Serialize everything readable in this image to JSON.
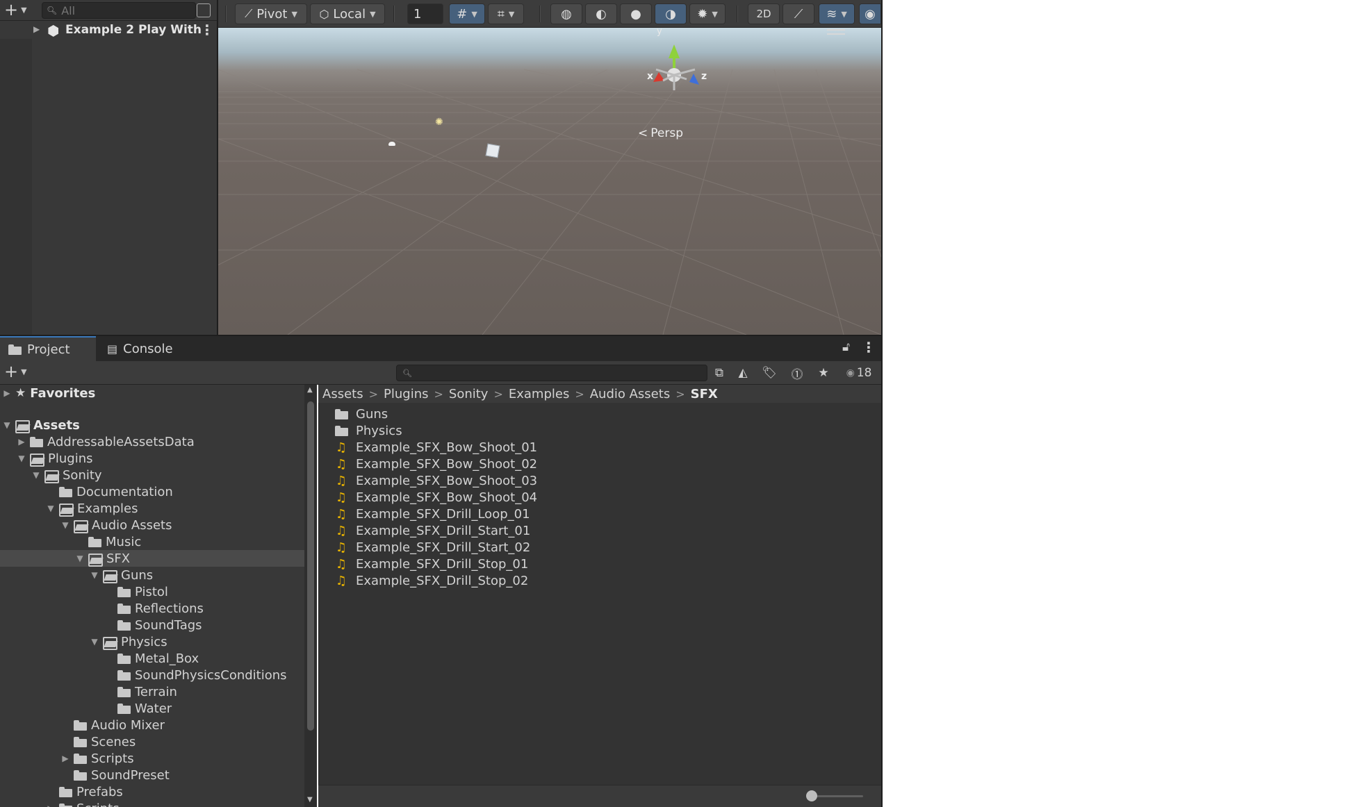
{
  "hierarchy": {
    "search_placeholder": "All",
    "scene_name": "Example 2 Play With"
  },
  "scene_toolbar": {
    "pivot": "Pivot",
    "local": "Local",
    "grid_snap_value": "1",
    "visible_count": "18"
  },
  "scene": {
    "gizmo_x": "x",
    "gizmo_y": "y",
    "gizmo_z": "z",
    "projection_label": "Persp"
  },
  "tabs": {
    "project": "Project",
    "console": "Console"
  },
  "folder_tree": [
    {
      "label": "Favorites",
      "indent": 0,
      "arrow": "▶",
      "icon": "star",
      "bold": true
    },
    {
      "label": "Assets",
      "indent": 0,
      "arrow": "▼",
      "icon": "open",
      "bold": true
    },
    {
      "label": "AddressableAssetsData",
      "indent": 1,
      "arrow": "▶",
      "icon": "folder"
    },
    {
      "label": "Plugins",
      "indent": 1,
      "arrow": "▼",
      "icon": "open"
    },
    {
      "label": "Sonity",
      "indent": 2,
      "arrow": "▼",
      "icon": "open"
    },
    {
      "label": "Documentation",
      "indent": 3,
      "arrow": "",
      "icon": "folder"
    },
    {
      "label": "Examples",
      "indent": 3,
      "arrow": "▼",
      "icon": "open"
    },
    {
      "label": "Audio Assets",
      "indent": 4,
      "arrow": "▼",
      "icon": "open"
    },
    {
      "label": "Music",
      "indent": 5,
      "arrow": "",
      "icon": "folder"
    },
    {
      "label": "SFX",
      "indent": 5,
      "arrow": "▼",
      "icon": "open",
      "selected": true
    },
    {
      "label": "Guns",
      "indent": 6,
      "arrow": "▼",
      "icon": "open"
    },
    {
      "label": "Pistol",
      "indent": 7,
      "arrow": "",
      "icon": "folder"
    },
    {
      "label": "Reflections",
      "indent": 7,
      "arrow": "",
      "icon": "folder"
    },
    {
      "label": "SoundTags",
      "indent": 7,
      "arrow": "",
      "icon": "folder"
    },
    {
      "label": "Physics",
      "indent": 6,
      "arrow": "▼",
      "icon": "open"
    },
    {
      "label": "Metal_Box",
      "indent": 7,
      "arrow": "",
      "icon": "folder"
    },
    {
      "label": "SoundPhysicsConditions",
      "indent": 7,
      "arrow": "",
      "icon": "folder"
    },
    {
      "label": "Terrain",
      "indent": 7,
      "arrow": "",
      "icon": "folder"
    },
    {
      "label": "Water",
      "indent": 7,
      "arrow": "",
      "icon": "folder"
    },
    {
      "label": "Audio Mixer",
      "indent": 4,
      "arrow": "",
      "icon": "folder"
    },
    {
      "label": "Scenes",
      "indent": 4,
      "arrow": "",
      "icon": "folder"
    },
    {
      "label": "Scripts",
      "indent": 4,
      "arrow": "▶",
      "icon": "folder"
    },
    {
      "label": "SoundPreset",
      "indent": 4,
      "arrow": "",
      "icon": "folder"
    },
    {
      "label": "Prefabs",
      "indent": 3,
      "arrow": "",
      "icon": "folder"
    },
    {
      "label": "Scripts",
      "indent": 3,
      "arrow": "▶",
      "icon": "folder"
    }
  ],
  "breadcrumb": [
    "Assets",
    "Plugins",
    "Sonity",
    "Examples",
    "Audio Assets",
    "SFX"
  ],
  "files": [
    {
      "label": "Guns",
      "type": "folder"
    },
    {
      "label": "Physics",
      "type": "folder"
    },
    {
      "label": "Example_SFX_Bow_Shoot_01",
      "type": "audio"
    },
    {
      "label": "Example_SFX_Bow_Shoot_02",
      "type": "audio"
    },
    {
      "label": "Example_SFX_Bow_Shoot_03",
      "type": "audio"
    },
    {
      "label": "Example_SFX_Bow_Shoot_04",
      "type": "audio"
    },
    {
      "label": "Example_SFX_Drill_Loop_01",
      "type": "audio"
    },
    {
      "label": "Example_SFX_Drill_Start_01",
      "type": "audio"
    },
    {
      "label": "Example_SFX_Drill_Start_02",
      "type": "audio"
    },
    {
      "label": "Example_SFX_Drill_Stop_01",
      "type": "audio"
    },
    {
      "label": "Example_SFX_Drill_Stop_02",
      "type": "audio"
    }
  ],
  "colors": {
    "accent": "#3a79bb",
    "audio_icon": "#e8b300",
    "gizmo_x": "#d9392e",
    "gizmo_y": "#8fd13b",
    "gizmo_z": "#3f6fd9"
  }
}
